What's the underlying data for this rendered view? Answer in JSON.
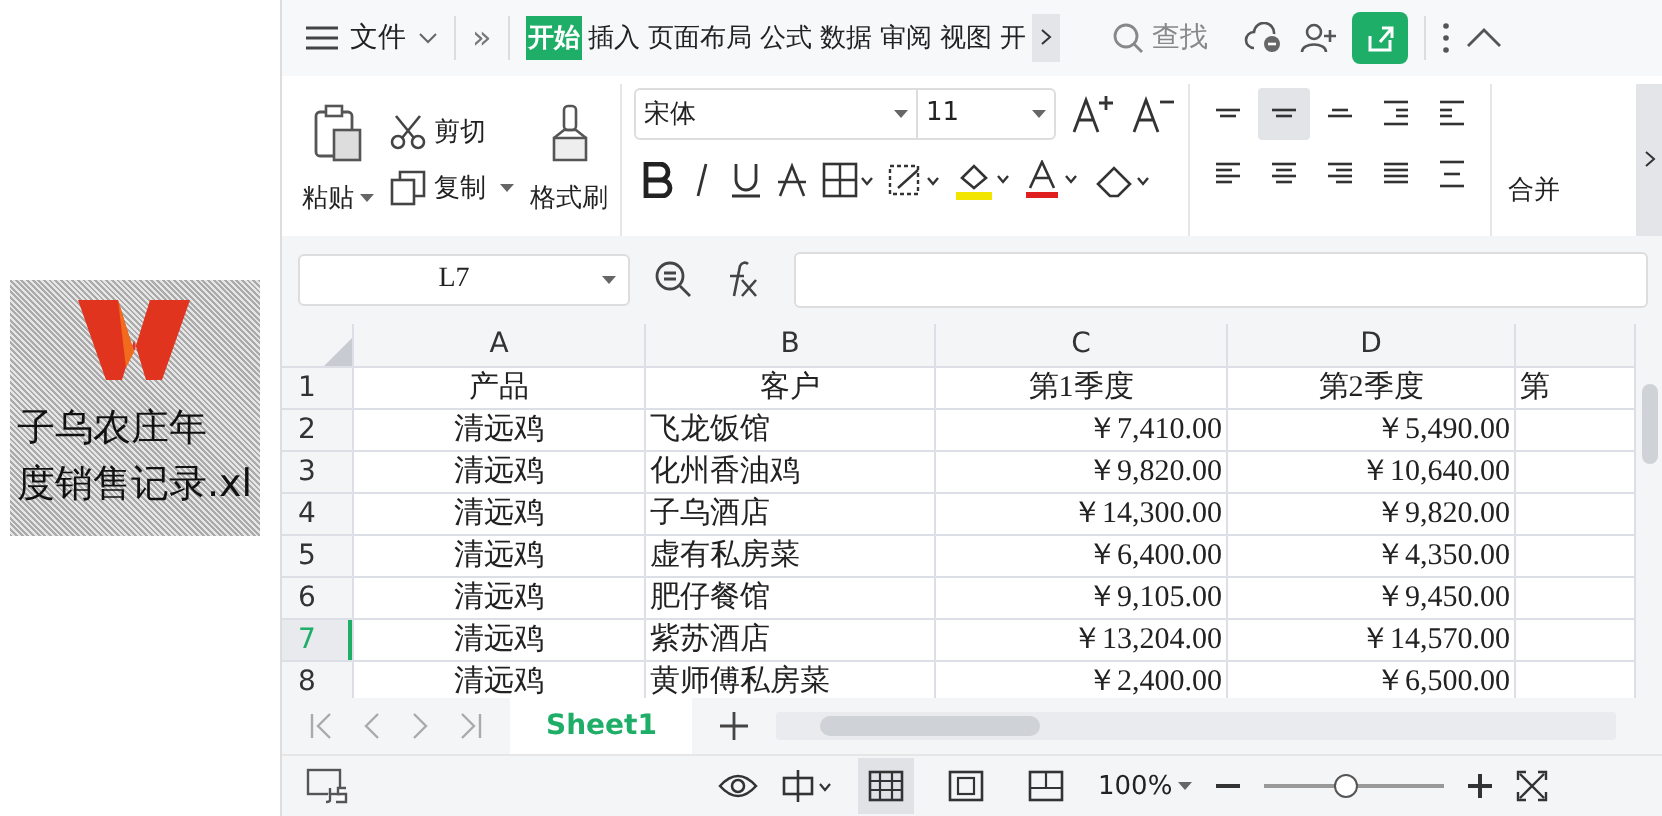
{
  "desktop_file": {
    "label_lines": [
      "子乌农庄年",
      "度销售记录.xl"
    ]
  },
  "menu": {
    "file_label": "文件",
    "more_glyph": "»"
  },
  "tabs": [
    {
      "label": "开始",
      "selected": true
    },
    {
      "label": "插入",
      "selected": false
    },
    {
      "label": "页面布局",
      "selected": false
    },
    {
      "label": "公式",
      "selected": false
    },
    {
      "label": "数据",
      "selected": false
    },
    {
      "label": "审阅",
      "selected": false
    },
    {
      "label": "视图",
      "selected": false
    },
    {
      "label": "开",
      "selected": false
    }
  ],
  "search": {
    "placeholder": "查找"
  },
  "clipboard": {
    "paste": "粘贴",
    "cut": "剪切",
    "copy": "复制",
    "format_painter": "格式刷"
  },
  "font": {
    "name": "宋体",
    "size": "11"
  },
  "align_buttons": [
    {
      "kind": "top",
      "selected": false
    },
    {
      "kind": "middle",
      "selected": true
    },
    {
      "kind": "bottom",
      "selected": false
    },
    {
      "kind": "outdent",
      "selected": false
    },
    {
      "kind": "indent",
      "selected": false
    },
    {
      "kind": "left",
      "selected": false
    },
    {
      "kind": "center",
      "selected": false
    },
    {
      "kind": "right",
      "selected": false
    },
    {
      "kind": "justify",
      "selected": false
    },
    {
      "kind": "distribute",
      "selected": false
    }
  ],
  "merge_label": "合并",
  "formula_bar": {
    "name_box": "L7"
  },
  "sheet": {
    "columns": [
      "A",
      "B",
      "C",
      "D"
    ],
    "rows": [
      {
        "number": "1",
        "selected": false,
        "cells": [
          "产品",
          "客户",
          "第1季度",
          "第2季度",
          "第"
        ]
      },
      {
        "number": "2",
        "selected": false,
        "cells": [
          "清远鸡",
          "飞龙饭馆",
          "￥7,410.00",
          "￥5,490.00",
          ""
        ]
      },
      {
        "number": "3",
        "selected": false,
        "cells": [
          "清远鸡",
          "化州香油鸡",
          "￥9,820.00",
          "￥10,640.00",
          ""
        ]
      },
      {
        "number": "4",
        "selected": false,
        "cells": [
          "清远鸡",
          "子乌酒店",
          "￥14,300.00",
          "￥9,820.00",
          ""
        ]
      },
      {
        "number": "5",
        "selected": false,
        "cells": [
          "清远鸡",
          "虚有私房菜",
          "￥6,400.00",
          "￥4,350.00",
          ""
        ]
      },
      {
        "number": "6",
        "selected": false,
        "cells": [
          "清远鸡",
          "肥仔餐馆",
          "￥9,105.00",
          "￥9,450.00",
          ""
        ]
      },
      {
        "number": "7",
        "selected": true,
        "cells": [
          "清远鸡",
          "紫苏酒店",
          "￥13,204.00",
          "￥14,570.00",
          ""
        ]
      },
      {
        "number": "8",
        "selected": false,
        "cells": [
          "清远鸡",
          "黄师傅私房菜",
          "￥2,400.00",
          "￥6,500.00",
          ""
        ]
      }
    ]
  },
  "sheet_tabs": [
    {
      "label": "Sheet1",
      "selected": true
    }
  ],
  "view_buttons": [
    {
      "kind": "normal",
      "selected": true
    },
    {
      "kind": "page",
      "selected": false
    },
    {
      "kind": "break",
      "selected": false
    }
  ],
  "zoom": {
    "label": "100%",
    "level": 0.45
  }
}
